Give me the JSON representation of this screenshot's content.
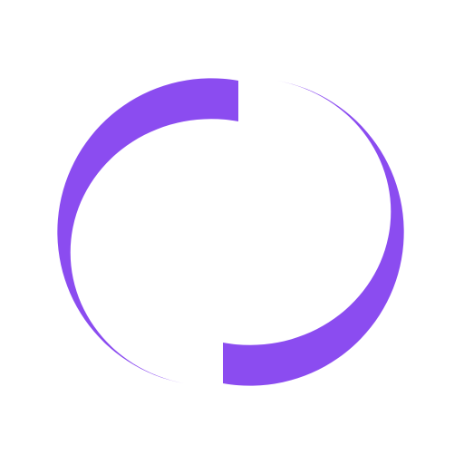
{
  "icon": {
    "name": "loading-spinner-icon",
    "color": "#8b4cf0",
    "background": "#ffffff"
  }
}
